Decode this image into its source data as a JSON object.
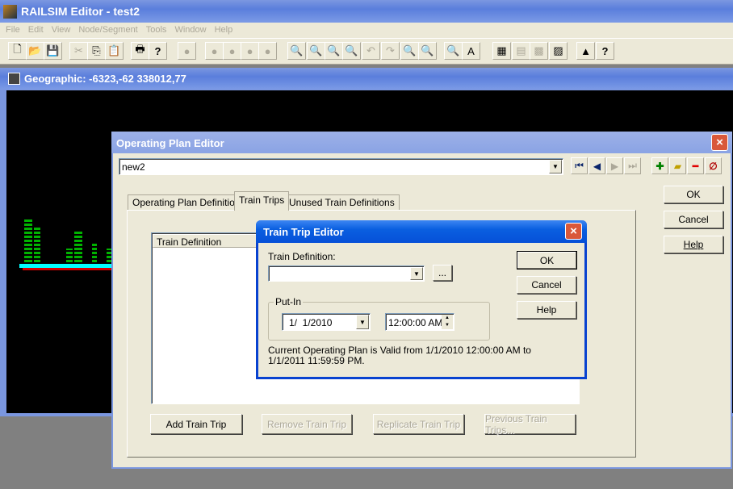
{
  "app": {
    "title": "RAILSIM Editor - test2",
    "menu": [
      "File",
      "Edit",
      "View",
      "Node/Segment",
      "Tools",
      "Window",
      "Help"
    ]
  },
  "toolbar": {
    "icons": [
      "new-file-icon",
      "open-folder-icon",
      "save-icon",
      "cut-icon",
      "copy-icon",
      "paste-icon",
      "print-icon",
      "help-icon",
      "node-icon",
      "node-add-icon",
      "node-link-icon",
      "node-edit-icon",
      "node-ok-icon",
      "zoom-window-icon",
      "zoom-extents-icon",
      "zoom-previous-icon",
      "zoom-in-icon",
      "undo-icon",
      "redo-icon",
      "zoom-multi-icon",
      "zoom-point-icon",
      "zoom-check-icon",
      "text-icon",
      "calculator-icon",
      "table-icon",
      "grid-icon",
      "chart-window-icon",
      "map-color-icon",
      "help-icon"
    ]
  },
  "geo_window": {
    "title": "Geographic: -6323,-62 338012,77",
    "colors": {
      "track": "#00ffff",
      "labels": "#00e000",
      "rail": "#ff0000"
    }
  },
  "op_editor": {
    "title": "Operating Plan Editor",
    "plan_value": "new2",
    "tabs": [
      "Operating Plan Definition",
      "Train Trips",
      "Unused Train Definitions"
    ],
    "active_tab": 1,
    "list_header": "Train Definition",
    "buttons": {
      "add": "Add Train Trip",
      "remove": "Remove Train Trip",
      "replicate": "Replicate Train Trip",
      "previous": "Previous Train Trips..."
    },
    "ok": "OK",
    "cancel": "Cancel",
    "help": "Help",
    "nav_icons": [
      "first-record-icon",
      "previous-record-icon",
      "next-record-icon",
      "last-record-icon",
      "add-icon",
      "new-folder-icon",
      "remove-icon",
      "clear-icon"
    ]
  },
  "trip_editor": {
    "title": "Train Trip Editor",
    "train_def_label": "Train Definition:",
    "train_def_value": "",
    "browse": "...",
    "putin_label": "Put-In",
    "date": "1/  1/2010",
    "time": "12:00:00 AM",
    "info": "Current Operating Plan is Valid from 1/1/2010 12:00:00 AM to 1/1/2011 11:59:59 PM.",
    "ok": "OK",
    "cancel": "Cancel",
    "help": "Help"
  }
}
